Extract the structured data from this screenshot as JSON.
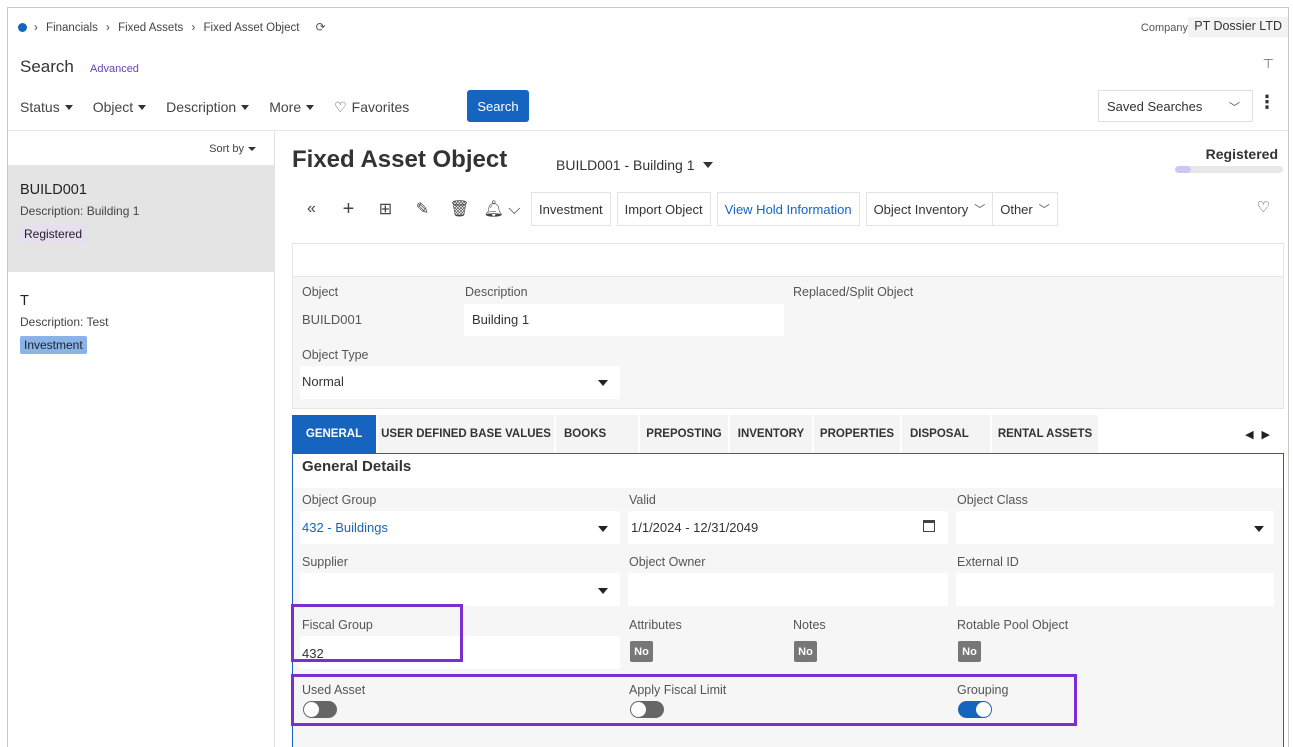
{
  "breadcrumb": {
    "items": [
      "Financials",
      "Fixed Assets",
      "Fixed Asset Object"
    ]
  },
  "company": {
    "label": "Company",
    "value": "PT Dossier LTD"
  },
  "search": {
    "title": "Search",
    "advanced": "Advanced",
    "button": "Search"
  },
  "filters": [
    {
      "label": "Status"
    },
    {
      "label": "Object"
    },
    {
      "label": "Description"
    },
    {
      "label": "More"
    },
    {
      "label": "Favorites"
    }
  ],
  "saved_searches": "Saved Searches",
  "list": {
    "sort_by": "Sort by",
    "items": [
      {
        "id": "BUILD001",
        "desc_label": "Description:",
        "desc_value": "Building 1",
        "badge": "Registered"
      },
      {
        "id": "T",
        "desc_label": "Description:",
        "desc_value": "Test",
        "badge": "Investment"
      }
    ]
  },
  "header": {
    "title": "Fixed Asset Object",
    "record": "BUILD001 - Building 1",
    "status": "Registered",
    "status_progress": 0.15
  },
  "toolbar": {
    "buttons": [
      "Investment",
      "Import Object",
      "View Hold Information",
      "Object Inventory",
      "Other"
    ],
    "icons": [
      "collapse-icon",
      "add-icon",
      "duplicate-icon",
      "edit-icon",
      "delete-icon",
      "bell-icon"
    ]
  },
  "object": {
    "object_label": "Object",
    "object_value": "BUILD001",
    "description_label": "Description",
    "description_value": "Building 1",
    "replaced_label": "Replaced/Split Object",
    "type_label": "Object Type",
    "type_value": "Normal"
  },
  "tabs": [
    "GENERAL",
    "USER DEFINED BASE VALUES",
    "BOOKS",
    "PREPOSTING",
    "INVENTORY",
    "PROPERTIES",
    "DISPOSAL",
    "RENTAL ASSETS"
  ],
  "general": {
    "title": "General Details",
    "object_group_label": "Object Group",
    "object_group_value": "432 - Buildings",
    "valid_label": "Valid",
    "valid_value": "1/1/2024 - 12/31/2049",
    "object_class_label": "Object Class",
    "supplier_label": "Supplier",
    "owner_label": "Object Owner",
    "external_label": "External ID",
    "fiscal_label": "Fiscal Group",
    "fiscal_value": "432",
    "attributes_label": "Attributes",
    "attributes_value": "No",
    "notes_label": "Notes",
    "notes_value": "No",
    "rotable_label": "Rotable Pool Object",
    "rotable_value": "No",
    "used_asset_label": "Used Asset",
    "used_asset_on": false,
    "fiscal_limit_label": "Apply Fiscal Limit",
    "fiscal_limit_on": false,
    "grouping_label": "Grouping",
    "grouping_on": true
  },
  "colors": {
    "accent": "#1565c0",
    "highlight": "#7b2fd0"
  }
}
